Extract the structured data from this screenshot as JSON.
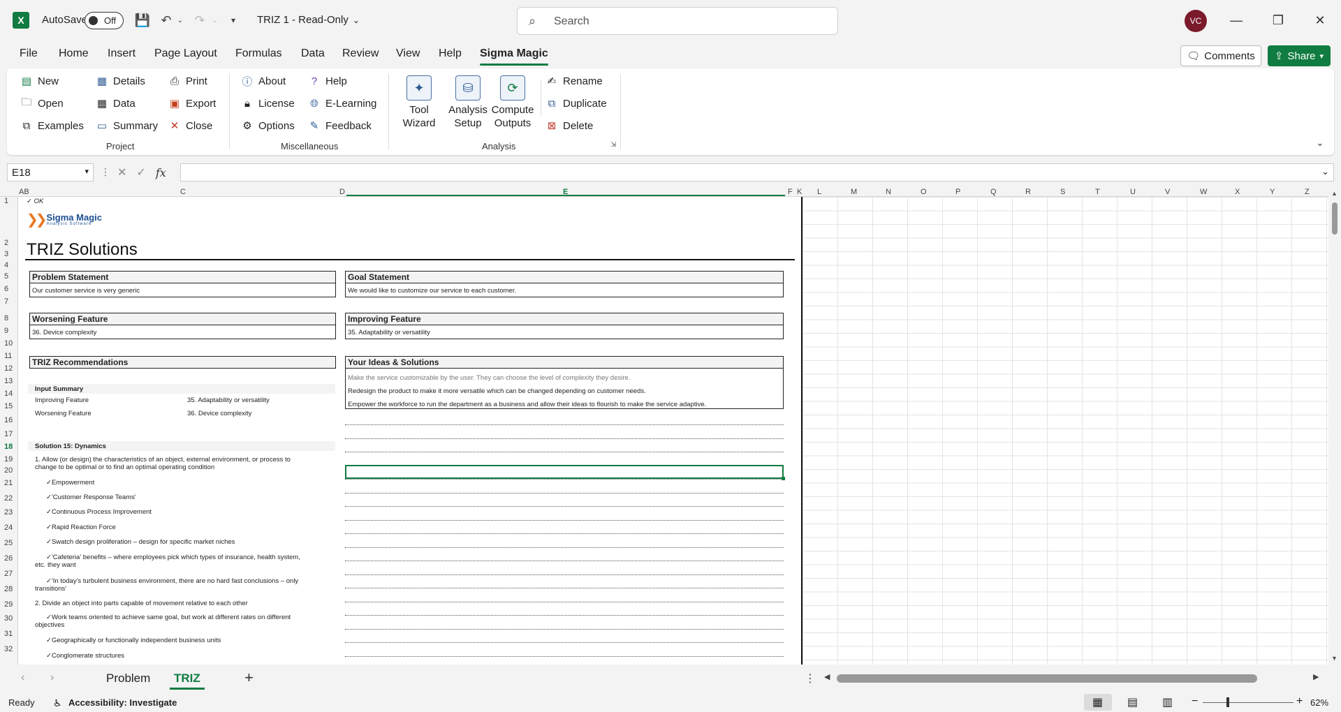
{
  "titlebar": {
    "app_icon": "excel-icon",
    "autosave_label": "AutoSave",
    "autosave_state": "Off",
    "doc_title": "TRIZ 1  -  Read-Only",
    "search_placeholder": "Search",
    "avatar_initials": "VC"
  },
  "menu": {
    "tabs": [
      "File",
      "Home",
      "Insert",
      "Page Layout",
      "Formulas",
      "Data",
      "Review",
      "View",
      "Help",
      "Sigma Magic"
    ],
    "active_tab": "Sigma Magic",
    "comments_label": "Comments",
    "share_label": "Share"
  },
  "ribbon": {
    "project": {
      "label": "Project",
      "buttons": [
        "New",
        "Open",
        "Examples",
        "Details",
        "Data",
        "Summary",
        "Print",
        "Export",
        "Close"
      ]
    },
    "misc": {
      "label": "Miscellaneous",
      "buttons": [
        "About",
        "License",
        "Options",
        "Help",
        "E-Learning",
        "Feedback"
      ]
    },
    "analysis": {
      "label": "Analysis",
      "large": [
        "Tool\nWizard",
        "Analysis\nSetup",
        "Compute\nOutputs"
      ],
      "buttons": [
        "Rename",
        "Duplicate",
        "Delete"
      ]
    }
  },
  "formula_bar": {
    "name_box": "E18",
    "fx": "fx"
  },
  "columns": [
    "AB",
    "C",
    "D",
    "E",
    "F",
    "K",
    "L",
    "M",
    "N",
    "O",
    "P",
    "Q",
    "R",
    "S",
    "T",
    "U",
    "V",
    "W",
    "X",
    "Y",
    "Z"
  ],
  "sheet": {
    "logo_line1": "Sigma Magic",
    "logo_line2": "Analysis Software",
    "top_text": "✓ OK",
    "title": "TRIZ Solutions",
    "problem_header": "Problem Statement",
    "problem_value": "Our customer service is very generic",
    "goal_header": "Goal Statement",
    "goal_value": "We would like to customize our service to each customer.",
    "worsening_header": "Worsening Feature",
    "worsening_value": "36. Device complexity",
    "improving_header": "Improving Feature",
    "improving_value": "35. Adaptability or versatility",
    "recs_header": "TRIZ Recommendations",
    "ideas_header": "Your Ideas & Solutions",
    "input_summary": "Input Summary",
    "improving_label": "Improving Feature",
    "improving_summary": "35. Adaptability or versatility",
    "worsening_label": "Worsening Feature",
    "worsening_summary": "36. Device complexity",
    "solution_title": "Solution 15: Dynamics",
    "recommendations": [
      "1. Allow (or design) the characteristics of an object, external environment, or process to",
      "change to be optimal or to find an optimal operating condition",
      "✓Empowerment",
      "✓'Customer Response Teams'",
      "✓Continuous Process Improvement",
      "✓Rapid Reaction Force",
      "✓Swatch design proliferation – design for specific market niches",
      "✓'Cafeteria' benefits – where employees pick which types of insurance, health system,",
      "etc. they want",
      "✓'In today's turbulent business environment, there are no hard fast conclusions – only",
      "transitions'",
      "2. Divide an object into parts capable of movement relative to each other",
      "✓Work teams oriented to achieve same goal, but work at different rates on different",
      "objectives",
      "✓Geographically or functionally independent business units",
      "✓Conglomerate structures"
    ],
    "ideas": [
      "Make the service customizable by the user. They can choose the level of complexity they desire.",
      "Redesign the product to make it more versatile which can be changed depending on customer needs.",
      "Empower the workforce to run the department as a business and allow their ideas to flourish to make the service adaptive."
    ]
  },
  "sheet_tabs": {
    "tabs": [
      "Problem",
      "TRIZ"
    ],
    "active": "TRIZ"
  },
  "status": {
    "ready": "Ready",
    "accessibility": "Accessibility: Investigate",
    "zoom": "62%"
  }
}
